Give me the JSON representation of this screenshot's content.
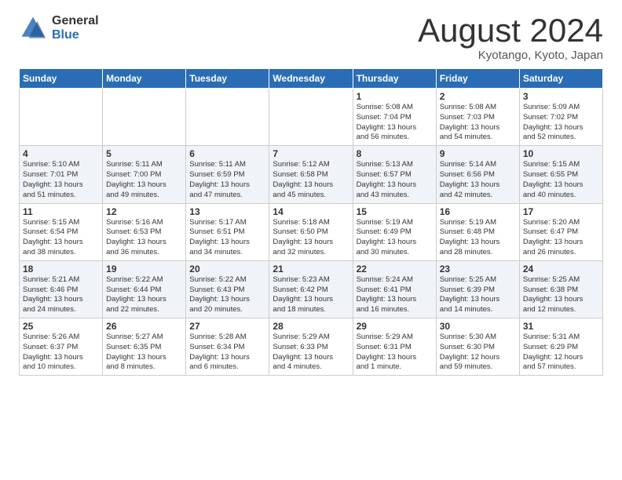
{
  "header": {
    "logo_general": "General",
    "logo_blue": "Blue",
    "month_title": "August 2024",
    "location": "Kyotango, Kyoto, Japan"
  },
  "weekdays": [
    "Sunday",
    "Monday",
    "Tuesday",
    "Wednesday",
    "Thursday",
    "Friday",
    "Saturday"
  ],
  "weeks": [
    [
      {
        "day": "",
        "info": ""
      },
      {
        "day": "",
        "info": ""
      },
      {
        "day": "",
        "info": ""
      },
      {
        "day": "",
        "info": ""
      },
      {
        "day": "1",
        "info": "Sunrise: 5:08 AM\nSunset: 7:04 PM\nDaylight: 13 hours\nand 56 minutes."
      },
      {
        "day": "2",
        "info": "Sunrise: 5:08 AM\nSunset: 7:03 PM\nDaylight: 13 hours\nand 54 minutes."
      },
      {
        "day": "3",
        "info": "Sunrise: 5:09 AM\nSunset: 7:02 PM\nDaylight: 13 hours\nand 52 minutes."
      }
    ],
    [
      {
        "day": "4",
        "info": "Sunrise: 5:10 AM\nSunset: 7:01 PM\nDaylight: 13 hours\nand 51 minutes."
      },
      {
        "day": "5",
        "info": "Sunrise: 5:11 AM\nSunset: 7:00 PM\nDaylight: 13 hours\nand 49 minutes."
      },
      {
        "day": "6",
        "info": "Sunrise: 5:11 AM\nSunset: 6:59 PM\nDaylight: 13 hours\nand 47 minutes."
      },
      {
        "day": "7",
        "info": "Sunrise: 5:12 AM\nSunset: 6:58 PM\nDaylight: 13 hours\nand 45 minutes."
      },
      {
        "day": "8",
        "info": "Sunrise: 5:13 AM\nSunset: 6:57 PM\nDaylight: 13 hours\nand 43 minutes."
      },
      {
        "day": "9",
        "info": "Sunrise: 5:14 AM\nSunset: 6:56 PM\nDaylight: 13 hours\nand 42 minutes."
      },
      {
        "day": "10",
        "info": "Sunrise: 5:15 AM\nSunset: 6:55 PM\nDaylight: 13 hours\nand 40 minutes."
      }
    ],
    [
      {
        "day": "11",
        "info": "Sunrise: 5:15 AM\nSunset: 6:54 PM\nDaylight: 13 hours\nand 38 minutes."
      },
      {
        "day": "12",
        "info": "Sunrise: 5:16 AM\nSunset: 6:53 PM\nDaylight: 13 hours\nand 36 minutes."
      },
      {
        "day": "13",
        "info": "Sunrise: 5:17 AM\nSunset: 6:51 PM\nDaylight: 13 hours\nand 34 minutes."
      },
      {
        "day": "14",
        "info": "Sunrise: 5:18 AM\nSunset: 6:50 PM\nDaylight: 13 hours\nand 32 minutes."
      },
      {
        "day": "15",
        "info": "Sunrise: 5:19 AM\nSunset: 6:49 PM\nDaylight: 13 hours\nand 30 minutes."
      },
      {
        "day": "16",
        "info": "Sunrise: 5:19 AM\nSunset: 6:48 PM\nDaylight: 13 hours\nand 28 minutes."
      },
      {
        "day": "17",
        "info": "Sunrise: 5:20 AM\nSunset: 6:47 PM\nDaylight: 13 hours\nand 26 minutes."
      }
    ],
    [
      {
        "day": "18",
        "info": "Sunrise: 5:21 AM\nSunset: 6:46 PM\nDaylight: 13 hours\nand 24 minutes."
      },
      {
        "day": "19",
        "info": "Sunrise: 5:22 AM\nSunset: 6:44 PM\nDaylight: 13 hours\nand 22 minutes."
      },
      {
        "day": "20",
        "info": "Sunrise: 5:22 AM\nSunset: 6:43 PM\nDaylight: 13 hours\nand 20 minutes."
      },
      {
        "day": "21",
        "info": "Sunrise: 5:23 AM\nSunset: 6:42 PM\nDaylight: 13 hours\nand 18 minutes."
      },
      {
        "day": "22",
        "info": "Sunrise: 5:24 AM\nSunset: 6:41 PM\nDaylight: 13 hours\nand 16 minutes."
      },
      {
        "day": "23",
        "info": "Sunrise: 5:25 AM\nSunset: 6:39 PM\nDaylight: 13 hours\nand 14 minutes."
      },
      {
        "day": "24",
        "info": "Sunrise: 5:25 AM\nSunset: 6:38 PM\nDaylight: 13 hours\nand 12 minutes."
      }
    ],
    [
      {
        "day": "25",
        "info": "Sunrise: 5:26 AM\nSunset: 6:37 PM\nDaylight: 13 hours\nand 10 minutes."
      },
      {
        "day": "26",
        "info": "Sunrise: 5:27 AM\nSunset: 6:35 PM\nDaylight: 13 hours\nand 8 minutes."
      },
      {
        "day": "27",
        "info": "Sunrise: 5:28 AM\nSunset: 6:34 PM\nDaylight: 13 hours\nand 6 minutes."
      },
      {
        "day": "28",
        "info": "Sunrise: 5:29 AM\nSunset: 6:33 PM\nDaylight: 13 hours\nand 4 minutes."
      },
      {
        "day": "29",
        "info": "Sunrise: 5:29 AM\nSunset: 6:31 PM\nDaylight: 13 hours\nand 1 minute."
      },
      {
        "day": "30",
        "info": "Sunrise: 5:30 AM\nSunset: 6:30 PM\nDaylight: 12 hours\nand 59 minutes."
      },
      {
        "day": "31",
        "info": "Sunrise: 5:31 AM\nSunset: 6:29 PM\nDaylight: 12 hours\nand 57 minutes."
      }
    ]
  ]
}
